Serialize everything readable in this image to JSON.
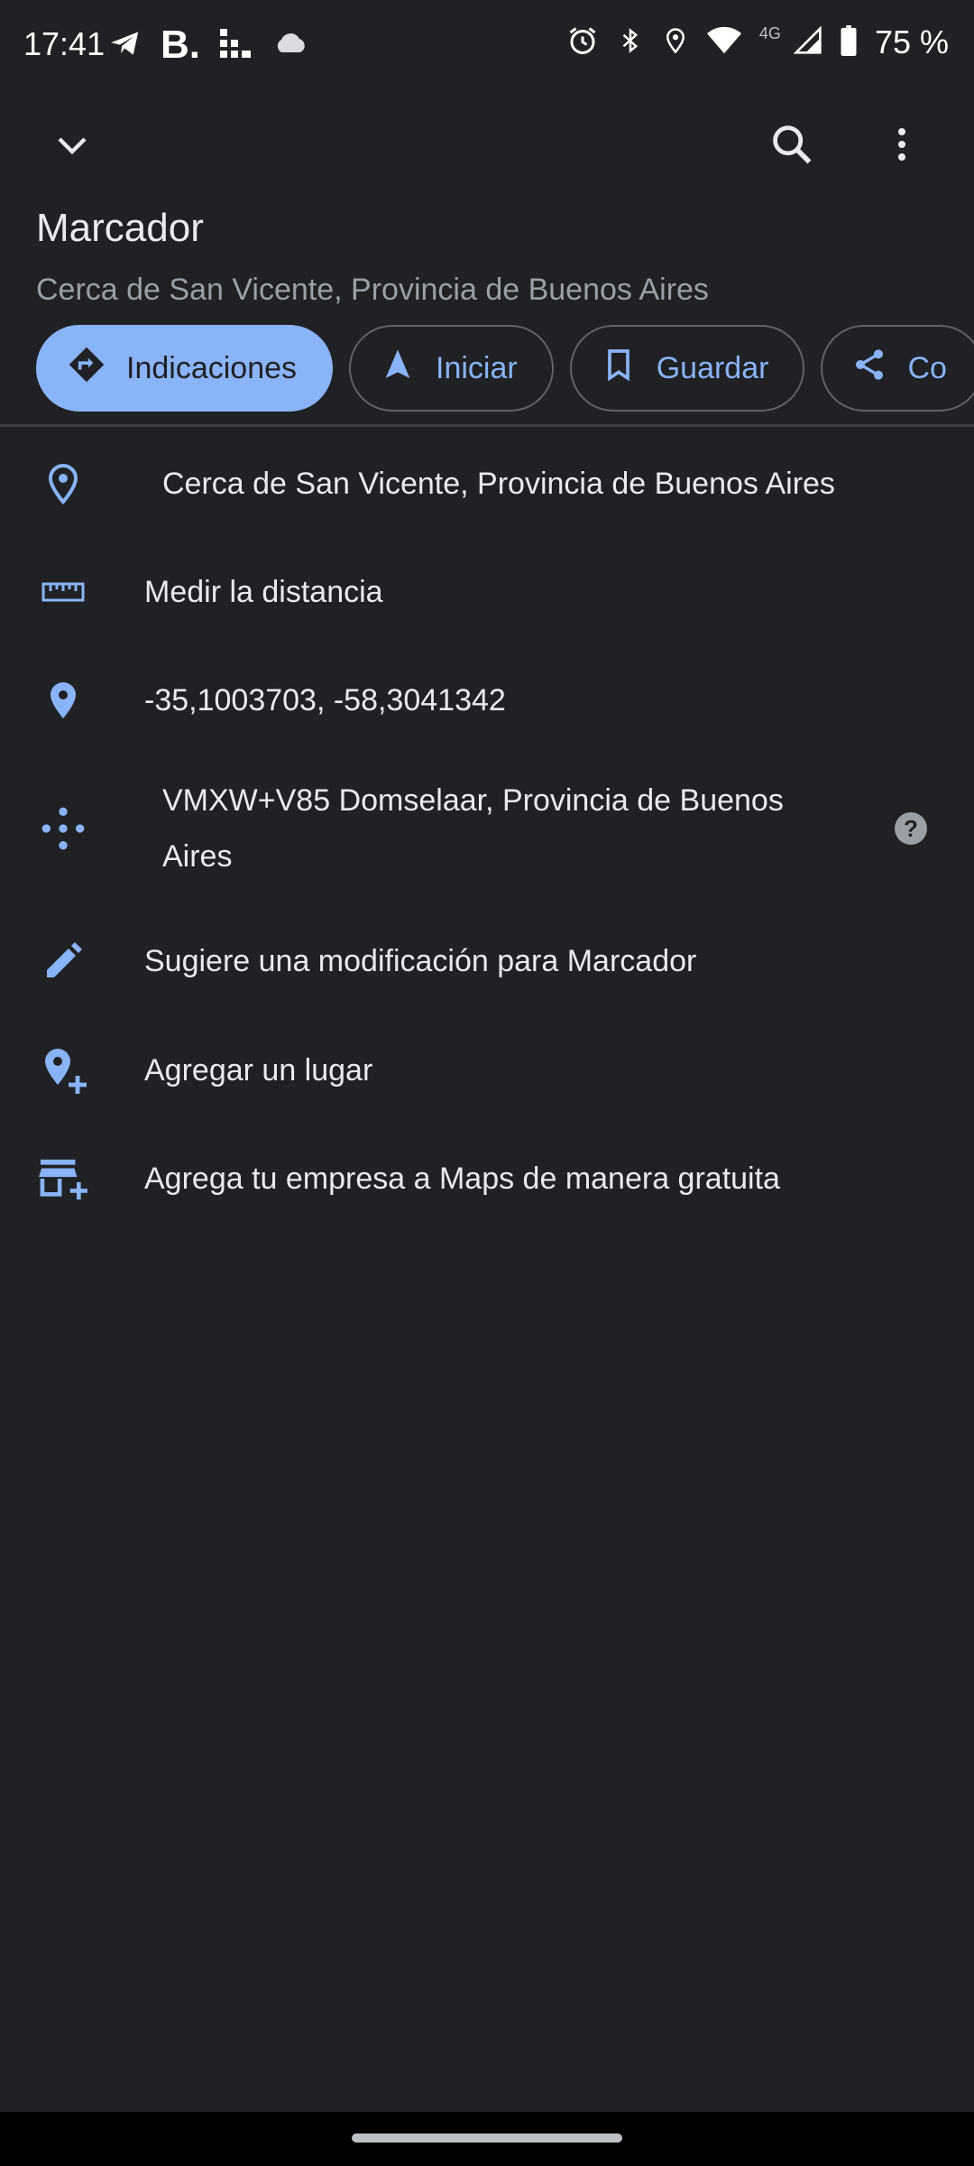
{
  "status_bar": {
    "time": "17:41",
    "left_icons": [
      "telegram-icon",
      "booking-icon",
      "stats-app-icon",
      "cloud-icon"
    ],
    "booking_letter": "B.",
    "right_icons": [
      "alarm-icon",
      "bluetooth-icon",
      "location-icon",
      "wifi-icon",
      "signal-icon",
      "battery-icon"
    ],
    "network_label": "4G",
    "battery_text": "75 %"
  },
  "top_bar": {
    "icons": [
      "chevron-down-icon",
      "search-icon",
      "more-vert-icon"
    ]
  },
  "place": {
    "title": "Marcador",
    "subtitle": "Cerca de San Vicente, Provincia de Buenos Aires"
  },
  "chips": [
    {
      "label": "Indicaciones",
      "icon": "directions-icon"
    },
    {
      "label": "Iniciar",
      "icon": "navigation-icon"
    },
    {
      "label": "Guardar",
      "icon": "bookmark-icon"
    },
    {
      "label": "Co",
      "icon": "share-icon"
    }
  ],
  "rows": [
    {
      "text": "Cerca de San Vicente, Provincia de Buenos Aires",
      "icon": "place-outline-icon"
    },
    {
      "text": "Medir la distancia",
      "icon": "ruler-icon"
    },
    {
      "text": "-35,1003703, -58,3041342",
      "icon": "place-filled-icon"
    },
    {
      "text_line1": "VMXW+V85 Domselaar, Provincia de Buenos",
      "text_line2": "Aires",
      "icon": "plus-code-icon",
      "help": "?"
    },
    {
      "text": "Sugiere una modificación para Marcador",
      "icon": "edit-icon"
    },
    {
      "text": "Agregar un lugar",
      "icon": "add-place-icon"
    },
    {
      "text": "Agrega tu empresa a Maps de manera gratuita",
      "icon": "add-business-icon"
    }
  ],
  "colors": {
    "background": "#202124",
    "accent": "#8ab4f8",
    "text_primary": "#e8eaed",
    "text_secondary": "#9aa0a6"
  }
}
